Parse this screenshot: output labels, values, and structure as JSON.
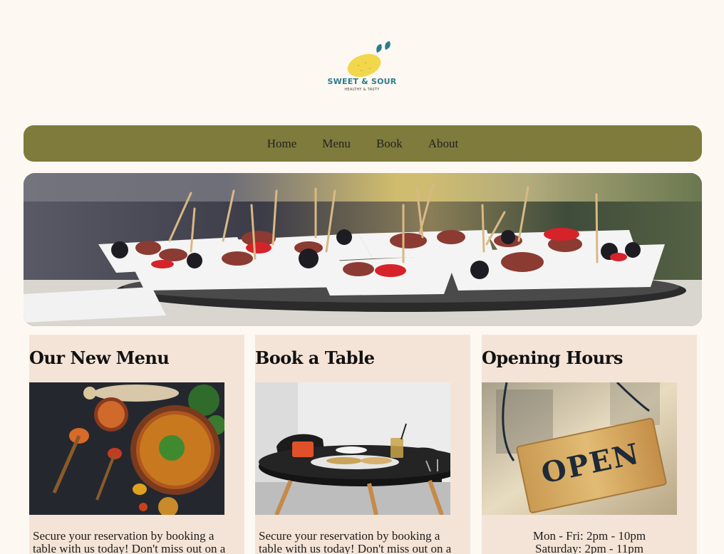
{
  "brand": {
    "name": "SWEET & SOUR",
    "tagline": "HEALTHY & TASTY"
  },
  "nav": {
    "items": [
      "Home",
      "Menu",
      "Book",
      "About"
    ]
  },
  "colors": {
    "background": "#fdf8f2",
    "nav": "#7e7b3c",
    "card": "#f4e4d7",
    "brand_teal": "#2a7d8a",
    "lemon": "#f2d64b"
  },
  "cards": [
    {
      "title": "Our New Menu",
      "text": "Secure your reservation by booking a table with us today! Don't miss out on a"
    },
    {
      "title": "Book a Table",
      "text": "Secure your reservation by booking a table with us today! Don't miss out on a"
    },
    {
      "title": "Opening Hours",
      "hours": [
        "Mon - Fri: 2pm - 10pm",
        "Saturday: 2pm - 11pm"
      ],
      "sign": "OPEN"
    }
  ]
}
